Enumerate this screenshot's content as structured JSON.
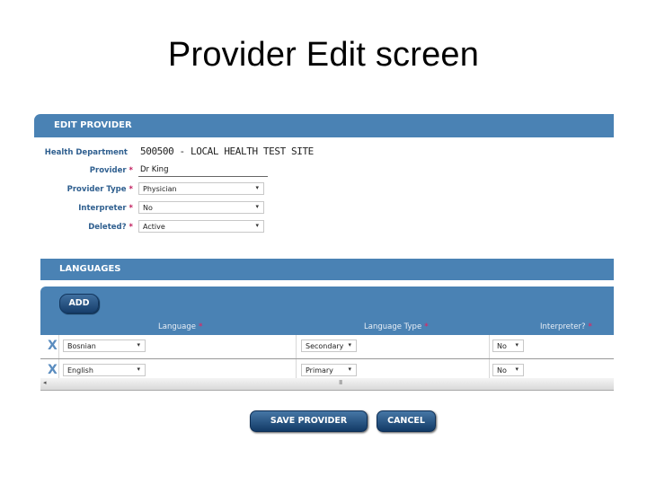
{
  "slide": {
    "title": "Provider Edit screen"
  },
  "edit_provider": {
    "header": "EDIT PROVIDER",
    "fields": {
      "health_department": {
        "label": "Health Department",
        "value": "500500 - LOCAL HEALTH TEST SITE"
      },
      "provider": {
        "label": "Provider",
        "required": "*",
        "value": "Dr King"
      },
      "provider_type": {
        "label": "Provider Type",
        "required": "*",
        "value": "Physician"
      },
      "interpreter": {
        "label": "Interpreter",
        "required": "*",
        "value": "No"
      },
      "deleted": {
        "label": "Deleted?",
        "required": "*",
        "value": "Active"
      }
    }
  },
  "languages": {
    "header": "LANGUAGES",
    "add_label": "ADD",
    "columns": [
      {
        "label": "Language",
        "required": "*"
      },
      {
        "label": "Language Type",
        "required": "*"
      },
      {
        "label": "Interpreter?",
        "required": "*"
      }
    ],
    "rows": [
      {
        "delete": "X",
        "language": "Bosnian",
        "language_type": "Secondary",
        "interpreter": "No"
      },
      {
        "delete": "X",
        "language": "English",
        "language_type": "Primary",
        "interpreter": "No"
      }
    ],
    "scroll": {
      "left_arrow": "◂",
      "grip": "III"
    }
  },
  "actions": {
    "save_label": "SAVE PROVIDER",
    "cancel_label": "CANCEL"
  },
  "icons": {
    "caret": "▾"
  },
  "colors": {
    "header_blue": "#4a82b4",
    "label_blue": "#2f5f8f",
    "required": "#c0185a",
    "button_dark": "#173e6b"
  }
}
